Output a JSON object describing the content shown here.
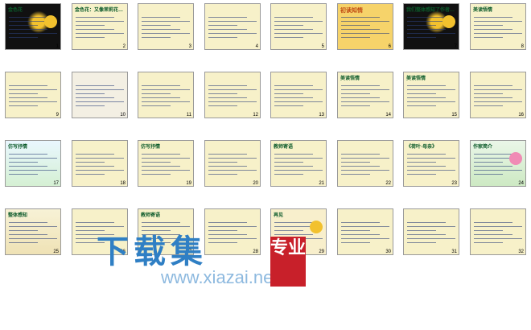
{
  "app": {
    "view": "Slide Sorter"
  },
  "slides": [
    {
      "number": "1",
      "title": "金色花",
      "subtitle": "泰戈尔"
    },
    {
      "number": "2",
      "title": "金色花：又像茉莉花…"
    },
    {
      "number": "3",
      "title": ""
    },
    {
      "number": "4",
      "title": ""
    },
    {
      "number": "5",
      "title": ""
    },
    {
      "number": "6",
      "title": "初读知情"
    },
    {
      "number": "7",
      "title": "我们整体感知了作者…"
    },
    {
      "number": "8",
      "title": "美读悟情"
    },
    {
      "number": "9",
      "title": ""
    },
    {
      "number": "10",
      "title": ""
    },
    {
      "number": "11",
      "title": ""
    },
    {
      "number": "12",
      "title": ""
    },
    {
      "number": "13",
      "title": ""
    },
    {
      "number": "14",
      "title": "美读悟情"
    },
    {
      "number": "15",
      "title": "美读悟情"
    },
    {
      "number": "16",
      "title": ""
    },
    {
      "number": "17",
      "title": "仿写抒情"
    },
    {
      "number": "18",
      "title": ""
    },
    {
      "number": "19",
      "title": "仿写抒情"
    },
    {
      "number": "20",
      "title": ""
    },
    {
      "number": "21",
      "title": "教师寄语"
    },
    {
      "number": "22",
      "title": ""
    },
    {
      "number": "23",
      "title": "《荷叶·母亲》"
    },
    {
      "number": "24",
      "title": "作家简介"
    },
    {
      "number": "25",
      "title": "整体感知"
    },
    {
      "number": "26",
      "title": ""
    },
    {
      "number": "27",
      "title": "教师寄语"
    },
    {
      "number": "28",
      "title": ""
    },
    {
      "number": "29",
      "title": "再见"
    },
    {
      "number": "30",
      "title": ""
    },
    {
      "number": "31",
      "title": ""
    },
    {
      "number": "32",
      "title": ""
    }
  ],
  "watermark": {
    "main": "下载集",
    "url": "www.xiazai.net",
    "box": "专业"
  }
}
